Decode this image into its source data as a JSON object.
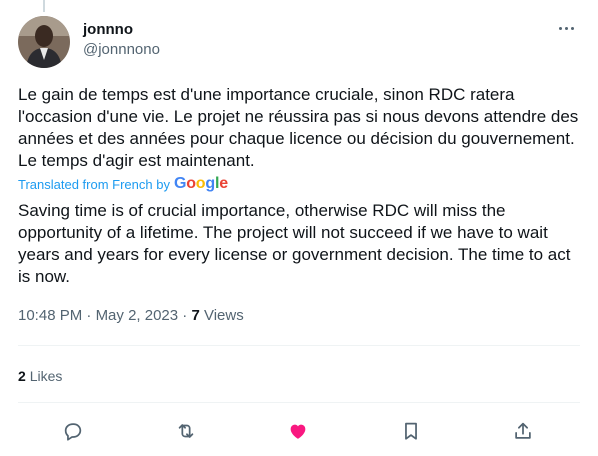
{
  "author": {
    "display_name": "jonnno",
    "handle": "@jonnnono"
  },
  "tweet": {
    "original_text": "Le gain de temps est d'une importance cruciale, sinon RDC ratera l'occasion d'une vie. Le projet ne réussira pas si nous devons attendre des années et des années pour chaque licence ou décision du gouvernement. Le temps d'agir est maintenant.",
    "translated_label": "Translated from French by",
    "translator_logo_text": "Google",
    "translation_text": "Saving time is of crucial importance, otherwise RDC will miss the opportunity of a lifetime. The project will not succeed if we have to wait years and years for every license or government decision. The time to act is now."
  },
  "meta": {
    "time": "10:48 PM",
    "separator": "·",
    "date": "May 2, 2023",
    "views_count": "7",
    "views_label": "Views"
  },
  "stats": {
    "likes_count": "2",
    "likes_label": "Likes"
  },
  "actions": {
    "icons": [
      "reply-icon",
      "retweet-icon",
      "like-icon",
      "bookmark-icon",
      "share-icon"
    ],
    "like_color": "#f91880",
    "icon_color": "#536471"
  },
  "colors": {
    "link": "#1d9bf0",
    "text": "#0f1419",
    "secondary": "#536471"
  }
}
